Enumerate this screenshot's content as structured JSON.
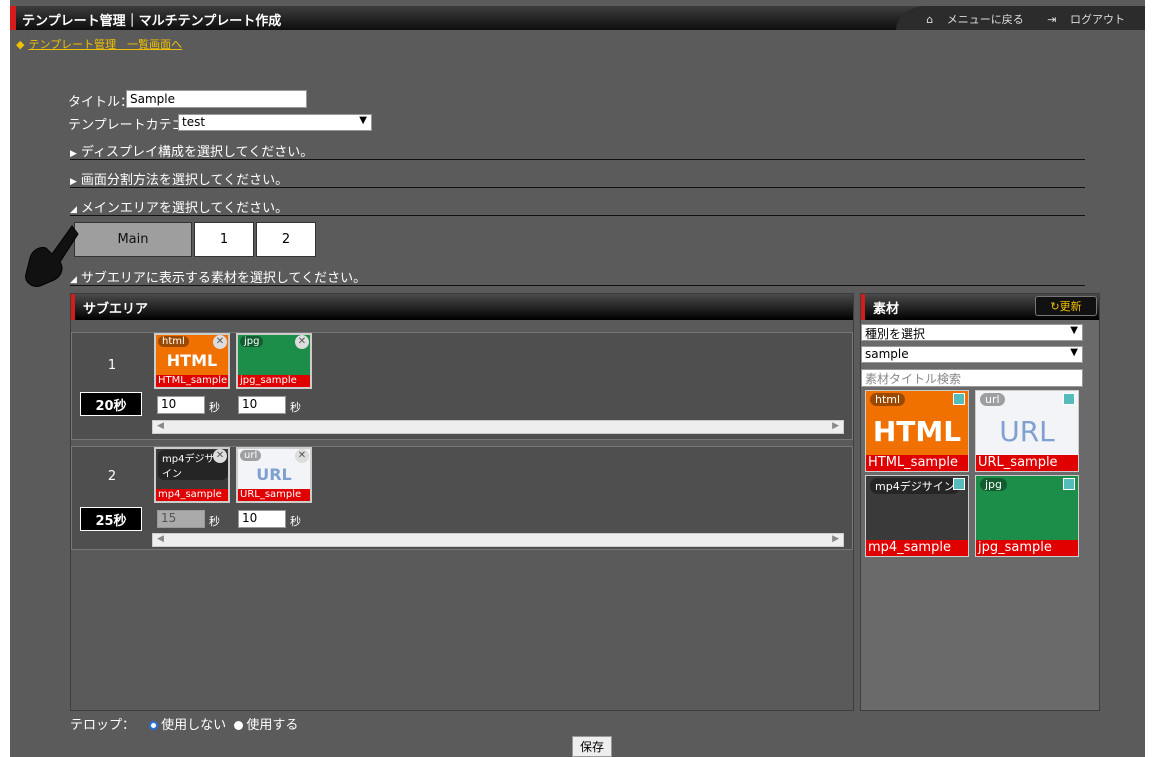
{
  "header": {
    "title": "テンプレート管理｜マルチテンプレート作成",
    "menu_back": "メニューに戻る",
    "logout": "ログアウト"
  },
  "breadcrumb": {
    "bullet": "◆",
    "link": "テンプレート管理　一覧画面へ"
  },
  "form": {
    "title_label": "タイトル：",
    "title_value": "Sample",
    "category_label": "テンプレートカテゴリ：",
    "category_value": "test"
  },
  "sections": {
    "display": "ディスプレイ構成を選択してください。",
    "split": "画面分割方法を選択してください。",
    "main_area": "メインエリアを選択してください。",
    "sub_material": "サブエリアに表示する素材を選択してください。"
  },
  "main_buttons": [
    "Main",
    "1",
    "2"
  ],
  "subarea": {
    "title": "サブエリア",
    "rows": [
      {
        "num": "1",
        "time": "20秒",
        "items": [
          {
            "tag": "html",
            "big": "HTML",
            "caption": "HTML_sample",
            "sec": "10",
            "sec_label": "秒"
          },
          {
            "tag": "jpg",
            "big": "",
            "caption": "jpg_sample",
            "sec": "10",
            "sec_label": "秒"
          }
        ]
      },
      {
        "num": "2",
        "time": "25秒",
        "items": [
          {
            "tag": "mp4デジサイン",
            "big": "",
            "caption": "mp4_sample",
            "sec": "15",
            "sec_label": "秒"
          },
          {
            "tag": "url",
            "big": "URL",
            "caption": "URL_sample",
            "sec": "10",
            "sec_label": "秒"
          }
        ]
      }
    ]
  },
  "materials": {
    "title": "素材",
    "refresh": "更新",
    "type_select": "種別を選択",
    "folder_select": "sample",
    "search_placeholder": "素材タイトル検索",
    "items": [
      {
        "tag": "html",
        "big": "HTML",
        "caption": "HTML_sample"
      },
      {
        "tag": "url",
        "big": "URL",
        "caption": "URL_sample"
      },
      {
        "tag": "mp4デジサイン",
        "big": "",
        "caption": "mp4_sample"
      },
      {
        "tag": "jpg",
        "big": "",
        "caption": "jpg_sample"
      }
    ]
  },
  "telop": {
    "label": "テロップ：",
    "option_off": "使用しない",
    "option_on": "使用する",
    "selected": "使用しない"
  },
  "save": "保存",
  "colors": {
    "accent": "#d51c1c",
    "caption_red": "#e00000",
    "link": "#f0c000",
    "panel": "#5b5b5b"
  }
}
